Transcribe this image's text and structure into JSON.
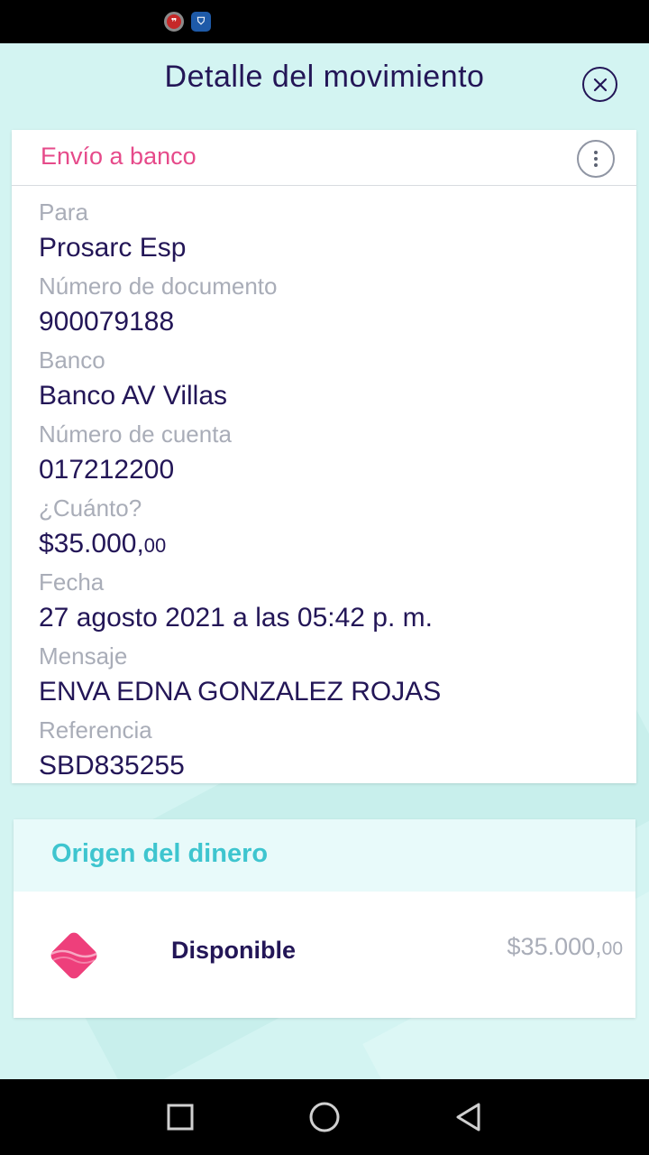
{
  "header": {
    "title": "Detalle del movimiento"
  },
  "detail": {
    "type": "Envío a banco",
    "fields": [
      {
        "label": "Para",
        "value": "Prosarc Esp"
      },
      {
        "label": "Número de documento",
        "value": "900079188"
      },
      {
        "label": "Banco",
        "value": "Banco AV Villas"
      },
      {
        "label": "Número de cuenta",
        "value": "017212200"
      },
      {
        "label": "¿Cuánto?",
        "value_main": "$35.000,",
        "value_cents": "00"
      },
      {
        "label": "Fecha",
        "value": "27 agosto 2021 a las 05:42 p. m."
      },
      {
        "label": "Mensaje",
        "value": "ENVA EDNA GONZALEZ ROJAS"
      },
      {
        "label": "Referencia",
        "value": "SBD835255"
      }
    ]
  },
  "origin": {
    "title": "Origen del dinero",
    "source_name": "Disponible",
    "amount_main": "$35.000,",
    "amount_cents": "00"
  },
  "colors": {
    "accent_pink": "#e64a8a",
    "accent_teal": "#3ec5cf",
    "text_dark": "#231657",
    "background": "#d3f4f2"
  },
  "icons": [
    "close-icon",
    "more-options-icon",
    "disponible-logo-icon",
    "nav-recents-icon",
    "nav-home-icon",
    "nav-back-icon"
  ]
}
